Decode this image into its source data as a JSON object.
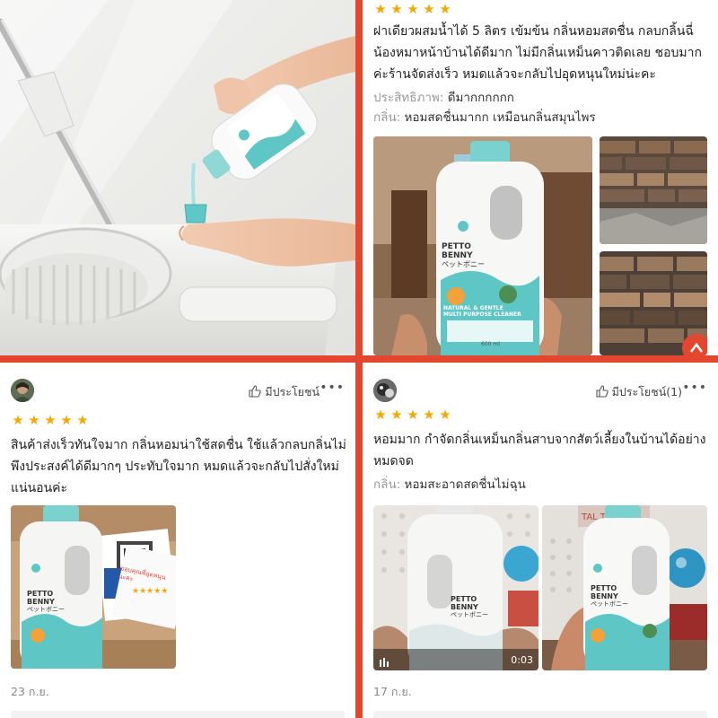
{
  "review_a": {
    "rating": 5,
    "text": "ฝาเดียวผสมน้ำได้ 5 ลิตร เข้มข้น กลิ่นหอมสดชื่น กลบกลิ้นฉี่น้องหมาหน้าบ้านได้ดีมาก ไม่มีกลิ่นเหม็นคาวติดเลย ชอบมากค่ะร้านจัดส่งเร็ว หมดแล้วจะกลับไปอุดหนุนใหม่น่ะคะ",
    "attr1_label": "ประสิทธิภาพ:",
    "attr1_value": "ดีมากกกกกก",
    "attr2_label": "กลิ่น:",
    "attr2_value": "หอมสดชื่นมากก เหมือนกลิ่นสมุนไพร"
  },
  "review_b": {
    "helpful_label": "มีประโยชน์",
    "rating": 5,
    "text": "สินค้าส่งเร็วทันใจมาก กลิ่นหอมน่าใช้สดชื่น ใช้แล้วกลบกลิ่นไม่พึงประสงค์ได้ดีมากๆ ประทับใจมาก หมดแล้วจะกลับไปสั่งใหม่แน่นอนค่ะ",
    "date": "23 ก.ย."
  },
  "review_c": {
    "helpful_label": "มีประโยชน์(1)",
    "rating": 5,
    "text": "หอมมาก กำจัดกลิ่นเหม็นกลิ่นสาบจากสัตว์เลี้ยงในบ้านได้อย่างหมดจด",
    "attr_label": "กลิ่น:",
    "attr_value": "หอมสะอาดสดชื่นไม่ฉุน",
    "video_duration": "0:03",
    "date": "17 ก.ย."
  },
  "product": {
    "brand_line1": "PETTO",
    "brand_line2": "BENNY",
    "brand_jp": "ペットボニー",
    "product_name_1": "NATURAL & GENTLE",
    "product_name_2": "MULTI PURPOSE CLEANER",
    "volume": "600 ml"
  },
  "sticker_text": "ขอบคุณที่อุดหนุนนะคะ",
  "colors": {
    "border": "#e4472f",
    "star": "#f6a800",
    "teal": "#5ec6c4"
  }
}
